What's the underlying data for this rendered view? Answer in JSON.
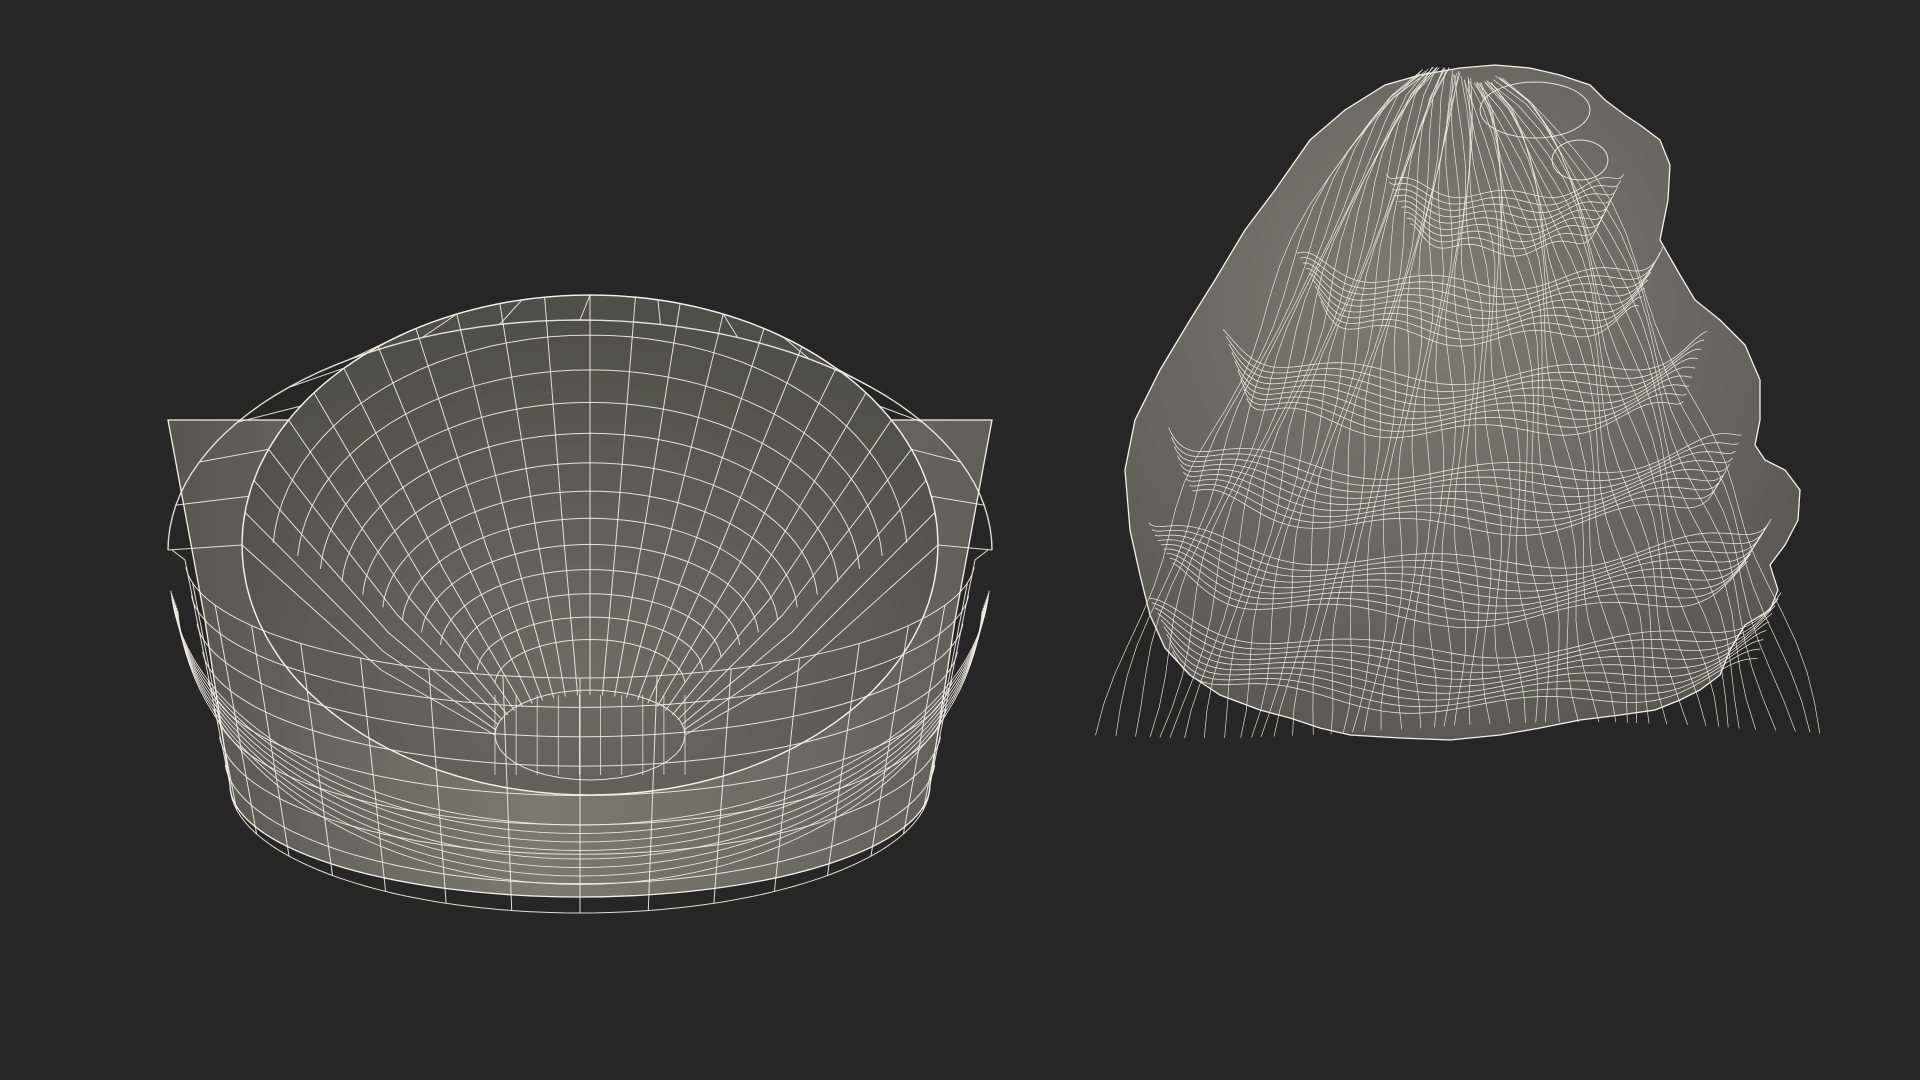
{
  "scene": {
    "background_color": "#262626",
    "mesh_fill_color": "#6f6f66",
    "mesh_fill_dark": "#56564f",
    "mesh_fill_light": "#858579",
    "wire_color": "#f2f1e6",
    "objects": [
      {
        "name": "bowl",
        "display": "wireframe-on-shaded"
      },
      {
        "name": "whipped-cream-swirl",
        "display": "wireframe-on-shaded"
      }
    ]
  }
}
